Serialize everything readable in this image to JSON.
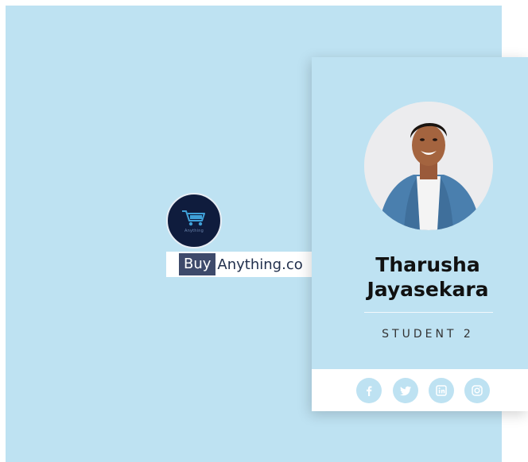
{
  "brand": {
    "logo_caption": "Anything",
    "buy_label": "Buy",
    "rest_label": "Anything.co"
  },
  "profile": {
    "name": "Tharusha Jayasekara",
    "role": "STUDENT 2"
  },
  "social": [
    {
      "icon": "facebook-icon"
    },
    {
      "icon": "twitter-icon"
    },
    {
      "icon": "linkedin-icon"
    },
    {
      "icon": "instagram-icon"
    }
  ],
  "colors": {
    "background": "#bee2f2",
    "card": "#bee2f2",
    "footer": "#ffffff",
    "social_circle": "#bee2f2",
    "logo_circle": "#0f1c3d",
    "brand_buy_bg": "#3e4a6b"
  }
}
